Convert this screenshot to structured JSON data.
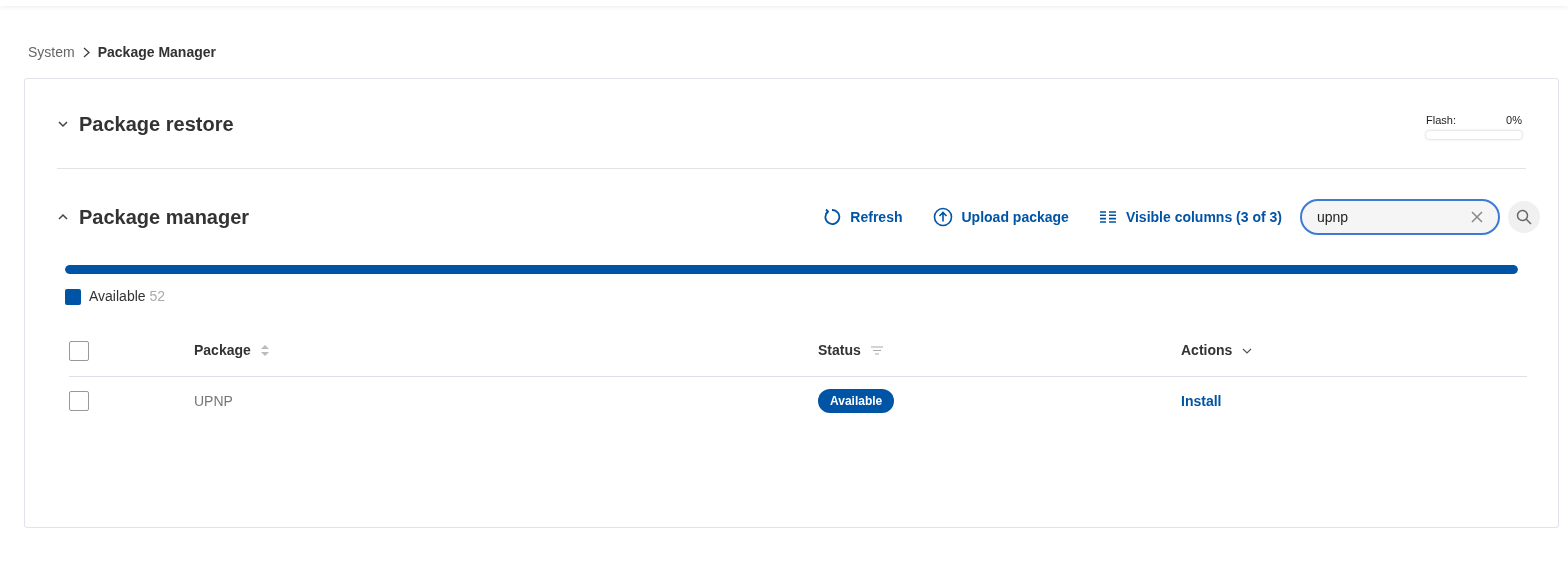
{
  "breadcrumb": [
    {
      "label": "System",
      "current": false
    },
    {
      "label": "Package Manager",
      "current": true
    }
  ],
  "restore": {
    "title": "Package restore",
    "expanded": false,
    "flash": {
      "label": "Flash:",
      "reading": "0%",
      "level": 0
    }
  },
  "manager": {
    "title": "Package manager",
    "expanded": true,
    "toolbar": [
      {
        "kind": "refresh",
        "label": "Refresh"
      },
      {
        "kind": "upload",
        "label": "Upload package"
      },
      {
        "kind": "columns",
        "label": "Visible columns (3 of 3)"
      }
    ],
    "search": {
      "value": "upnp"
    },
    "bar": {
      "level": 1,
      "color": "#0054a6"
    },
    "legend": [
      {
        "label": "Available",
        "count": "52",
        "color": "#0054a6"
      }
    ],
    "table": {
      "select_all": {
        "checked": false
      },
      "columns": [
        {
          "label": "Package",
          "kind": "sort"
        },
        {
          "label": "Status",
          "kind": "filter"
        },
        {
          "label": "Actions",
          "kind": "menu"
        }
      ],
      "rows": [
        {
          "checked": false,
          "package": "UPNP",
          "status": "Available",
          "action": "Install"
        }
      ]
    }
  }
}
